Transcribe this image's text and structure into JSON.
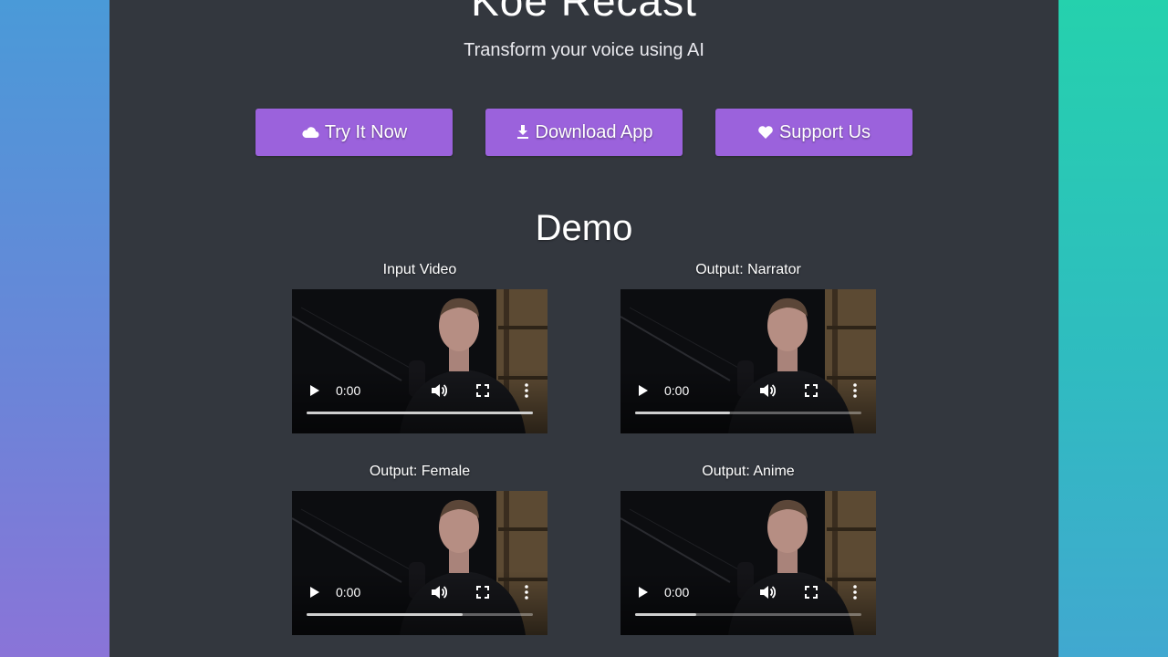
{
  "header": {
    "title": "Koe Recast",
    "subtitle": "Transform your voice using AI"
  },
  "buttons": [
    {
      "label": "Try It Now",
      "icon": "cloud-icon"
    },
    {
      "label": "Download App",
      "icon": "download-icon"
    },
    {
      "label": "Support Us",
      "icon": "heart-icon"
    }
  ],
  "demo": {
    "heading": "Demo",
    "videos": [
      {
        "label": "Input Video",
        "time": "0:00",
        "progress": 1.0
      },
      {
        "label": "Output: Narrator",
        "time": "0:00",
        "progress": 0.42
      },
      {
        "label": "Output: Female",
        "time": "0:00",
        "progress": 0.69
      },
      {
        "label": "Output: Anime",
        "time": "0:00",
        "progress": 0.27
      }
    ]
  },
  "colors": {
    "panel": "#33373e",
    "button": "#9b62dc"
  }
}
